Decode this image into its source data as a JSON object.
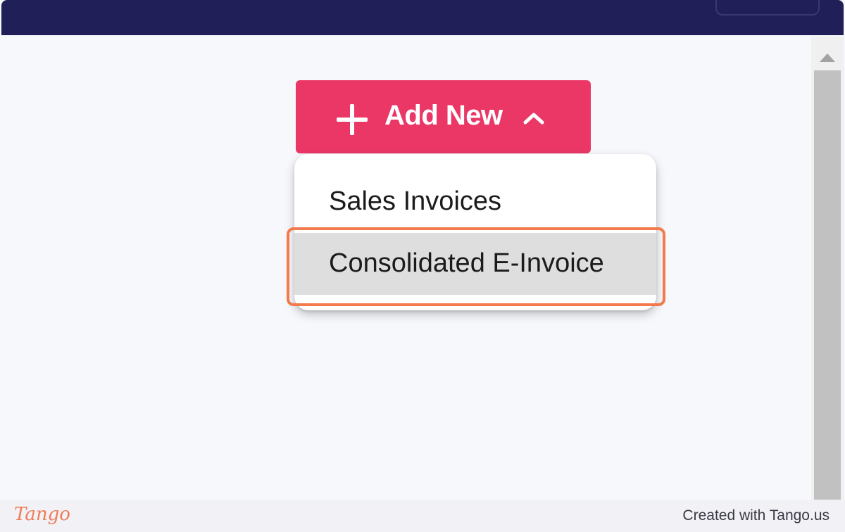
{
  "add_new": {
    "label": "Add New",
    "color": "#ea3766"
  },
  "dropdown": {
    "items": [
      {
        "label": "Sales Invoices"
      },
      {
        "label": "Consolidated E-Invoice",
        "highlighted": true
      }
    ]
  },
  "highlight_color": "#f27a4c",
  "topbar_color": "#211f57",
  "footer": {
    "logo": "Tango",
    "credit": "Created with Tango.us"
  }
}
